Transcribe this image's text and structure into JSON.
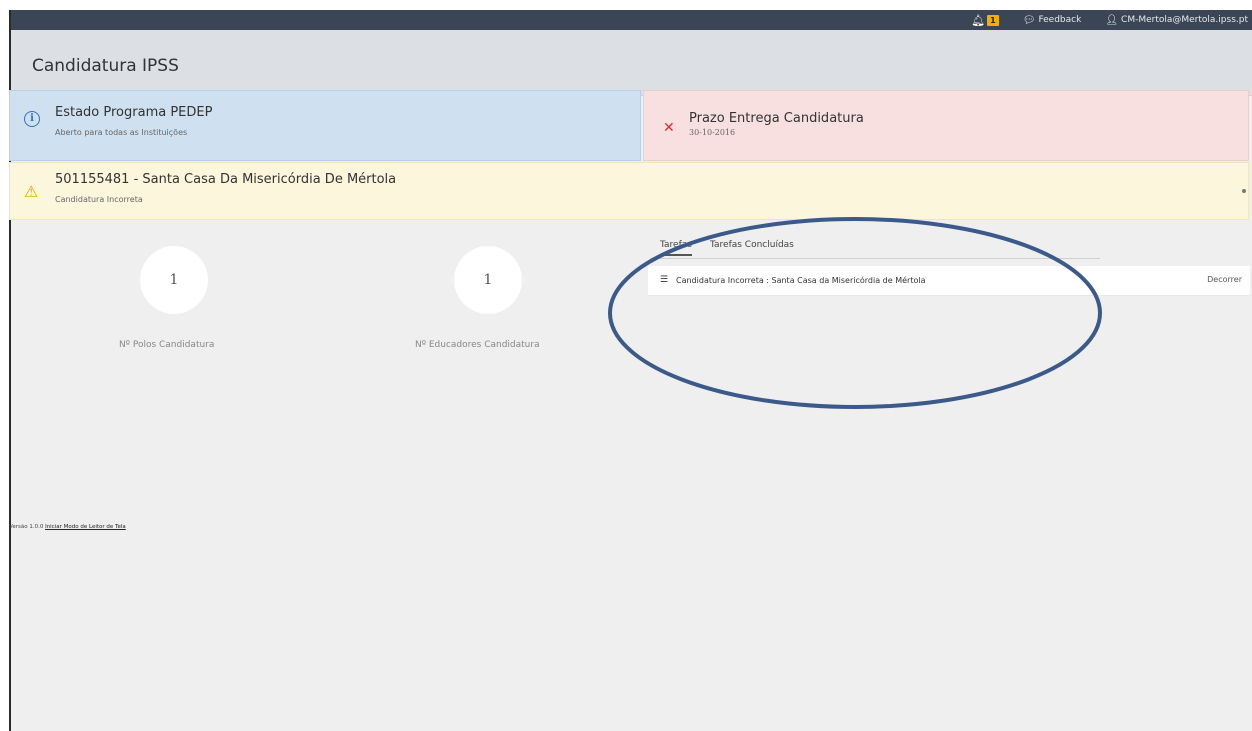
{
  "topbar": {
    "notification_count": "1",
    "feedback_label": "Feedback",
    "user_label": "CM-Mertola@Mertola.ipss.pt"
  },
  "page": {
    "title": "Candidatura IPSS"
  },
  "alerts": {
    "program_status": {
      "title": "Estado Programa PEDEP",
      "subtitle": "Aberto para todas as Instituições"
    },
    "deadline": {
      "title": "Prazo Entrega Candidatura",
      "subtitle": "30-10-2016"
    },
    "institution": {
      "title": "501155481 - Santa Casa Da Misericórdia De Mértola",
      "subtitle": "Candidatura Incorreta"
    }
  },
  "stats": [
    {
      "value": "1",
      "label": "Nº Polos Candidatura"
    },
    {
      "value": "1",
      "label": "Nº Educadores Candidatura"
    }
  ],
  "tasks": {
    "tabs": [
      "Tarefas",
      "Tarefas Concluídas"
    ],
    "items": [
      {
        "text": "Candidatura Incorreta : Santa Casa da Misericórdia de Mértola",
        "action": "Decorrer"
      }
    ]
  },
  "footer": {
    "version": "Versão 1.0.0",
    "link": "Iniciar Modo de Leitor de Tela"
  },
  "colors": {
    "topbar": "#3a4655",
    "info_bg": "#cfe0f0",
    "error_bg": "#f8e0e0",
    "warning_bg": "#fbf6dc",
    "annotation_stroke": "#3b5a8a"
  }
}
